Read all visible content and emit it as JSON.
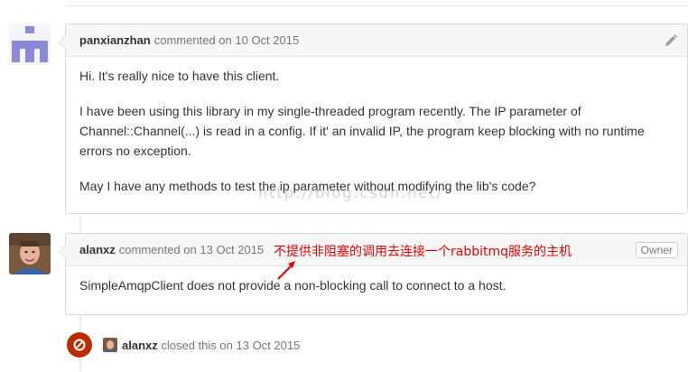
{
  "comments": [
    {
      "author": "panxianzhan",
      "action": "commented on",
      "date": "10 Oct 2015",
      "paragraphs": [
        "Hi. It's really nice to have this client.",
        "I have been using this library in my single-threaded program recently. The IP parameter of Channel::Channel(...) is read in a config. If it' an invalid IP, the program keep blocking with no runtime errors no exception.",
        "May I have any methods to test the ip parameter without modifying the lib's code?"
      ],
      "edit_icon": "pencil-icon"
    },
    {
      "author": "alanxz",
      "action": "commented on",
      "date": "13 Oct 2015",
      "badge": "Owner",
      "annotation": "不提供非阻塞的调用去连接一个rabbitmq服务的主机",
      "annotation_color": "#e00000",
      "paragraphs": [
        "SimpleAmqpClient does not provide a non-blocking call to connect to a host."
      ]
    }
  ],
  "event": {
    "author": "alanxz",
    "action": "closed this on",
    "date": "13 Oct 2015",
    "icon": "closed-circle-icon",
    "badge_color": "#bd2c00"
  },
  "watermark": "http://blog.csdn.net/"
}
